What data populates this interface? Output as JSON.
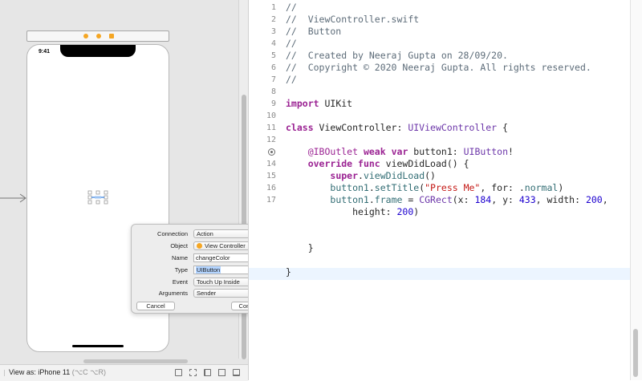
{
  "canvas": {
    "status_time": "9:41",
    "bottom_bar": {
      "view_as": "View as: iPhone 11",
      "shortcut_1": "⌥C",
      "shortcut_2": "⌥R",
      "tools": [
        "update-frames-icon",
        "embed-in-icon",
        "align-icon",
        "add-constraints-icon",
        "resolve-issues-icon"
      ]
    },
    "accent_color": "#f5a623"
  },
  "popover": {
    "fields": [
      {
        "label": "Connection",
        "value": "Action",
        "kind": "select"
      },
      {
        "label": "Object",
        "value": "View Controller",
        "kind": "select"
      },
      {
        "label": "Name",
        "value": "changeColor",
        "kind": "input"
      },
      {
        "label": "Type",
        "value": "UIButton",
        "kind": "combo"
      },
      {
        "label": "Event",
        "value": "Touch Up Inside",
        "kind": "select"
      },
      {
        "label": "Arguments",
        "value": "Sender",
        "kind": "select"
      }
    ],
    "cancel_label": "Cancel",
    "connect_label": "Connect"
  },
  "editor": {
    "lines": [
      {
        "n": "1",
        "seg": [
          {
            "c": "cm",
            "t": "//"
          }
        ]
      },
      {
        "n": "2",
        "seg": [
          {
            "c": "cm",
            "t": "//  ViewController.swift"
          }
        ]
      },
      {
        "n": "3",
        "seg": [
          {
            "c": "cm",
            "t": "//  Button"
          }
        ]
      },
      {
        "n": "4",
        "seg": [
          {
            "c": "cm",
            "t": "//"
          }
        ]
      },
      {
        "n": "5",
        "seg": [
          {
            "c": "cm",
            "t": "//  Created by Neeraj Gupta on 28/09/20."
          }
        ]
      },
      {
        "n": "6",
        "seg": [
          {
            "c": "cm",
            "t": "//  Copyright © 2020 Neeraj Gupta. All rights reserved."
          }
        ]
      },
      {
        "n": "7",
        "seg": [
          {
            "c": "cm",
            "t": "//"
          }
        ]
      },
      {
        "n": "8",
        "seg": []
      },
      {
        "n": "9",
        "seg": [
          {
            "c": "kw",
            "t": "import"
          },
          {
            "c": "",
            "t": " UIKit"
          }
        ]
      },
      {
        "n": "10",
        "seg": []
      },
      {
        "n": "11",
        "seg": [
          {
            "c": "kw",
            "t": "class"
          },
          {
            "c": "",
            "t": " ViewController: "
          },
          {
            "c": "ty",
            "t": "UIViewController"
          },
          {
            "c": "",
            "t": " {"
          }
        ]
      },
      {
        "n": "12",
        "seg": []
      },
      {
        "n": "",
        "seg": [
          {
            "c": "",
            "t": "    "
          },
          {
            "c": "at",
            "t": "@IBOutlet"
          },
          {
            "c": "",
            "t": " "
          },
          {
            "c": "kw",
            "t": "weak"
          },
          {
            "c": "",
            "t": " "
          },
          {
            "c": "kw",
            "t": "var"
          },
          {
            "c": "",
            "t": " button1: "
          },
          {
            "c": "ty",
            "t": "UIButton"
          },
          {
            "c": "",
            "t": "!"
          }
        ]
      },
      {
        "n": "14",
        "seg": [
          {
            "c": "",
            "t": "    "
          },
          {
            "c": "kw",
            "t": "override"
          },
          {
            "c": "",
            "t": " "
          },
          {
            "c": "kw",
            "t": "func"
          },
          {
            "c": "",
            "t": " viewDidLoad() {"
          }
        ]
      },
      {
        "n": "15",
        "seg": [
          {
            "c": "",
            "t": "        "
          },
          {
            "c": "kw",
            "t": "super"
          },
          {
            "c": "",
            "t": "."
          },
          {
            "c": "mb",
            "t": "viewDidLoad"
          },
          {
            "c": "",
            "t": "()"
          }
        ]
      },
      {
        "n": "16",
        "seg": [
          {
            "c": "",
            "t": "        "
          },
          {
            "c": "mb",
            "t": "button1"
          },
          {
            "c": "",
            "t": "."
          },
          {
            "c": "mb",
            "t": "setTitle"
          },
          {
            "c": "",
            "t": "("
          },
          {
            "c": "st",
            "t": "\"Press Me\""
          },
          {
            "c": "",
            "t": ", for: ."
          },
          {
            "c": "mb",
            "t": "normal"
          },
          {
            "c": "",
            "t": ")"
          }
        ]
      },
      {
        "n": "17",
        "seg": [
          {
            "c": "",
            "t": "        "
          },
          {
            "c": "mb",
            "t": "button1"
          },
          {
            "c": "",
            "t": "."
          },
          {
            "c": "mb",
            "t": "frame"
          },
          {
            "c": "",
            "t": " = "
          },
          {
            "c": "ty",
            "t": "CGRect"
          },
          {
            "c": "",
            "t": "(x: "
          },
          {
            "c": "nu",
            "t": "184"
          },
          {
            "c": "",
            "t": ", y: "
          },
          {
            "c": "nu",
            "t": "433"
          },
          {
            "c": "",
            "t": ", width: "
          },
          {
            "c": "nu",
            "t": "200"
          },
          {
            "c": "",
            "t": ","
          }
        ]
      },
      {
        "n": "",
        "seg": [
          {
            "c": "",
            "t": "            height: "
          },
          {
            "c": "nu",
            "t": "200"
          },
          {
            "c": "",
            "t": ")"
          }
        ]
      },
      {
        "n": "",
        "seg": []
      },
      {
        "n": "",
        "seg": []
      },
      {
        "n": "",
        "seg": [
          {
            "c": "",
            "t": "    }"
          }
        ]
      },
      {
        "n": "",
        "seg": []
      },
      {
        "n": "",
        "seg": [
          {
            "c": "",
            "t": "}"
          }
        ]
      }
    ]
  }
}
